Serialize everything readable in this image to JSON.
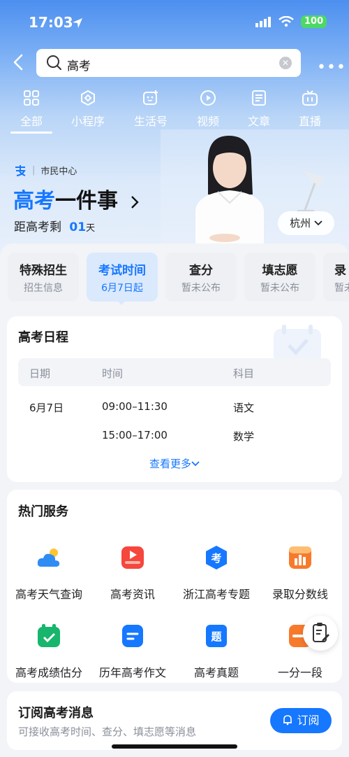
{
  "status_bar": {
    "time": "17:03",
    "battery": "100"
  },
  "search": {
    "query": "高考"
  },
  "categories": [
    {
      "label": "全部",
      "icon": "grid-icon"
    },
    {
      "label": "小程序",
      "icon": "mini-program-icon"
    },
    {
      "label": "生活号",
      "icon": "life-account-icon"
    },
    {
      "label": "视频",
      "icon": "video-icon"
    },
    {
      "label": "文章",
      "icon": "article-icon"
    },
    {
      "label": "直播",
      "icon": "live-icon"
    }
  ],
  "hero": {
    "brand": "市民中心",
    "title_blue": "高考",
    "title_rest": "一件事",
    "countdown_prefix": "距高考剩",
    "countdown_num": "01",
    "countdown_unit": "天",
    "city": "杭州"
  },
  "tabs": [
    {
      "title": "特殊招生",
      "sub": "招生信息"
    },
    {
      "title": "考试时间",
      "sub": "6月7日起"
    },
    {
      "title": "查分",
      "sub": "暂未公布"
    },
    {
      "title": "填志愿",
      "sub": "暂未公布"
    },
    {
      "title": "录",
      "sub": "暂未"
    }
  ],
  "schedule": {
    "title": "高考日程",
    "headers": [
      "日期",
      "时间",
      "科目"
    ],
    "rows": [
      {
        "date": "6月7日",
        "time": "09:00–11:30",
        "subject": "语文"
      },
      {
        "date": "",
        "time": "15:00–17:00",
        "subject": "数学"
      }
    ],
    "see_more": "查看更多"
  },
  "services": {
    "title": "热门服务",
    "items": [
      {
        "label": "高考天气查询",
        "icon": "weather-icon",
        "color": "#2f8cf3"
      },
      {
        "label": "高考资讯",
        "icon": "news-play-icon",
        "color": "#f5473d"
      },
      {
        "label": "浙江高考专题",
        "icon": "exam-badge-icon",
        "color": "#1677ff"
      },
      {
        "label": "录取分数线",
        "icon": "bar-chart-icon",
        "color": "#f77a2c"
      },
      {
        "label": "高考成绩估分",
        "icon": "check-calendar-icon",
        "color": "#17b66c"
      },
      {
        "label": "历年高考作文",
        "icon": "essay-icon",
        "color": "#1677ff"
      },
      {
        "label": "高考真题",
        "icon": "question-icon",
        "color": "#1677ff"
      },
      {
        "label": "一分一段",
        "icon": "score-segment-icon",
        "color": "#f77a2c"
      }
    ],
    "badge_char": "考",
    "question_char": "题"
  },
  "subscribe": {
    "title": "订阅高考消息",
    "desc": "可接收高考时间、查分、填志愿等消息",
    "button": "订阅"
  }
}
